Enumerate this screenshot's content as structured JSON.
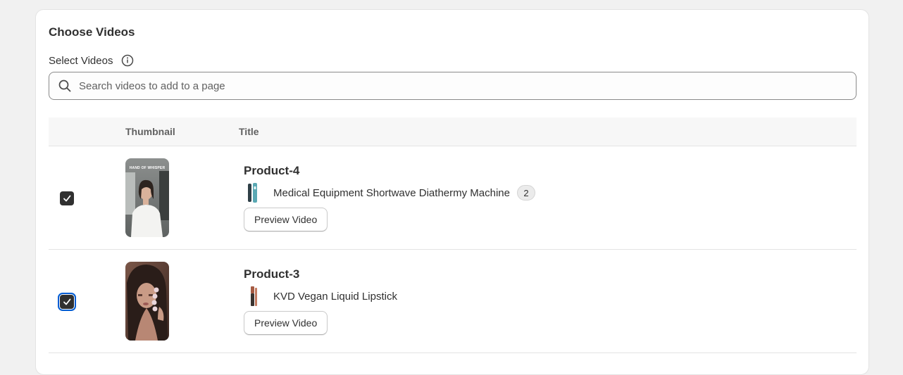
{
  "card": {
    "title": "Choose Videos",
    "select_label": "Select Videos",
    "search_placeholder": "Search videos to add to a page"
  },
  "table": {
    "headers": [
      "",
      "Thumbnail",
      "Title"
    ]
  },
  "rows": [
    {
      "checked": true,
      "thumbnail_caption": "HAND OF WHISPER",
      "title": "Product-4",
      "product_name": "Medical Equipment Shortwave Diathermy Machine",
      "badge": "2",
      "button": "Preview Video"
    },
    {
      "checked": true,
      "title": "Product-3",
      "product_name": "KVD Vegan Liquid Lipstick",
      "button": "Preview Video"
    }
  ],
  "colors": {
    "page_bg": "#f1f1f1",
    "card_bg": "#ffffff",
    "checkbox": "#303030",
    "focus_ring": "#005bd3"
  }
}
